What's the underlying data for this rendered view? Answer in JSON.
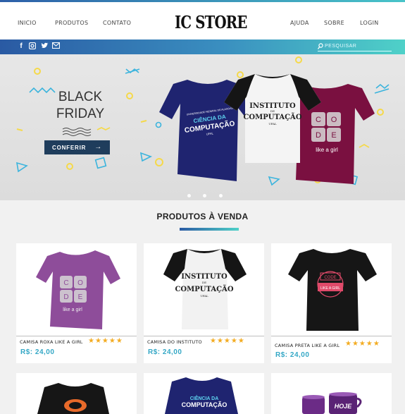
{
  "nav": {
    "left": [
      "INICIO",
      "PRODUTOS",
      "CONTATO"
    ],
    "logo": "IC STORE",
    "right": [
      "AJUDA",
      "SOBRE",
      "LOGIN"
    ]
  },
  "social": [
    "facebook-icon",
    "instagram-icon",
    "twitter-icon",
    "mail-icon"
  ],
  "search": {
    "placeholder": "PESQUISAR"
  },
  "hero": {
    "line1": "BLACK",
    "line2": "FRIDAY",
    "cta": "CONFERIR",
    "tshirt_blue": {
      "small": "UNIVERSIDADE FEDERAL DE ALAGOAS",
      "main": "CIÊNCIA DA",
      "main2": "COMPUTAÇÃO",
      "sub": "UFAL"
    },
    "tshirt_white": {
      "main": "INSTITUTO",
      "de": "DE",
      "main2": "COMPUTAÇÃO",
      "sub": "UFAL"
    },
    "tshirt_wine": {
      "letters": [
        "C",
        "O",
        "D",
        "E"
      ],
      "caption": "like a girl"
    },
    "slides": 3
  },
  "section": {
    "title": "PRODUTOS À VENDA"
  },
  "products": [
    {
      "name": "CAMISA ROXA LIKE A GIRL",
      "price": "R$: 24,00",
      "rating": 5,
      "stars": "★★★★★"
    },
    {
      "name": "CAMISA DO INSTITUTO",
      "price": "R$: 24,00",
      "rating": 5,
      "stars": "★★★★★"
    },
    {
      "name": "CAMISA PRETA LIKE A GIRL",
      "price": "R$: 24,00",
      "rating": 5,
      "stars": "★★★★★"
    }
  ],
  "product_art": {
    "purple": {
      "letters": [
        "C",
        "O",
        "D",
        "E"
      ],
      "caption": "like a girl"
    },
    "white": {
      "main": "INSTITUTO",
      "de": "DE",
      "main2": "COMPUTAÇÃO",
      "sub": "UFAL"
    },
    "black": {
      "top": "CODE",
      "caption": "LIKE A GIRL"
    },
    "row2_blue": {
      "main": "CIÊNCIA DA",
      "main2": "COMPUTAÇÃO"
    },
    "row2_mug": {
      "text": "HOJE"
    }
  },
  "colors": {
    "accent_blue": "#2a5aa3",
    "accent_teal": "#4fd1c8",
    "price": "#35a8c6",
    "star": "#f3ac22",
    "cta_bg": "#1f3d5c"
  }
}
